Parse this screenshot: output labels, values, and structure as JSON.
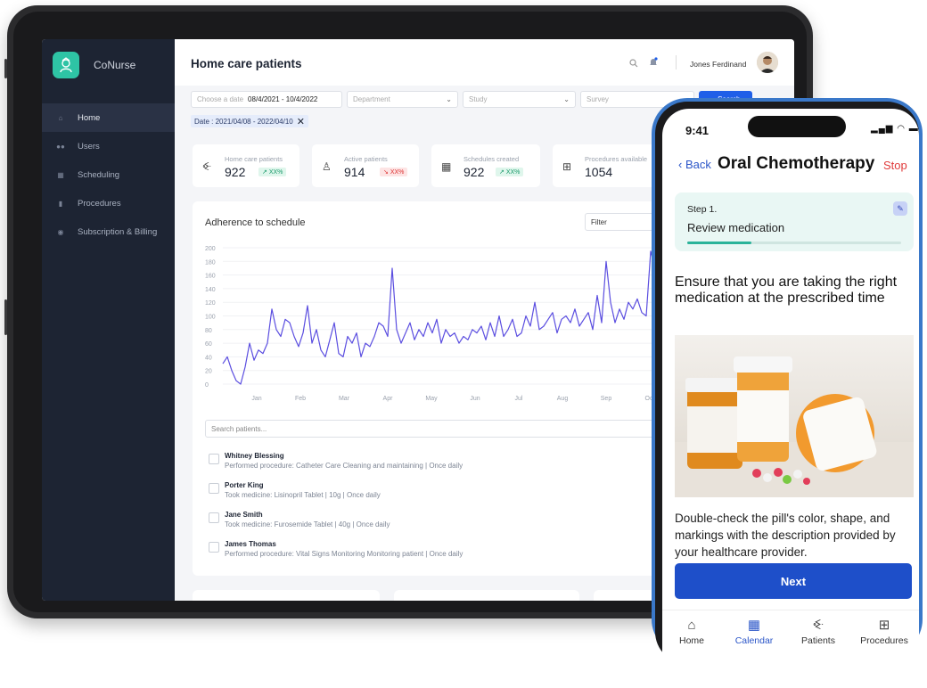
{
  "dashboard": {
    "brand": "CoNurse",
    "sidebar": {
      "items": [
        {
          "label": "Home",
          "icon": "home-icon"
        },
        {
          "label": "Users",
          "icon": "users-icon"
        },
        {
          "label": "Scheduling",
          "icon": "calendar-icon"
        },
        {
          "label": "Procedures",
          "icon": "clipboard-icon"
        },
        {
          "label": "Subscription & Billing",
          "icon": "billing-icon"
        }
      ]
    },
    "header": {
      "title": "Home care patients",
      "user_name": "Jones Ferdinand"
    },
    "filters": {
      "date_placeholder": "Choose a date",
      "date_value": "08/4/2021 - 10/4/2022",
      "department": "Department",
      "study": "Study",
      "survey": "Survey",
      "search_label": "Search",
      "date_chip": "Date : 2021/04/08 - 2022/04/10"
    },
    "stats": [
      {
        "label": "Home care patients",
        "value": "922",
        "change": "XX%",
        "trend": "up"
      },
      {
        "label": "Active patients",
        "value": "914",
        "change": "XX%",
        "trend": "down"
      },
      {
        "label": "Schedules created",
        "value": "922",
        "change": "XX%",
        "trend": "up"
      },
      {
        "label": "Procedures available",
        "value": "1054"
      }
    ],
    "chart_card": {
      "title": "Adherence to schedule",
      "filter": "Filter"
    },
    "patients_search_placeholder": "Search patients...",
    "patients": [
      {
        "name": "Whitney Blessing",
        "desc": "Performed procedure: Catheter Care  Cleaning and maintaining  |  Once daily"
      },
      {
        "name": "Porter King",
        "desc": "Took medicine:  Lisinopril  Tablet  |  10g  |  Once daily"
      },
      {
        "name": "Jane Smith",
        "desc": "Took medicine:  Furosemide  Tablet  |  40g  |  Once daily"
      },
      {
        "name": "James Thomas",
        "desc": "Performed procedure: Vital Signs Monitoring  Monitoring patient  |  Once daily"
      }
    ]
  },
  "chart_data": {
    "type": "line",
    "title": "Adherence to schedule",
    "xlabel": "",
    "ylabel": "",
    "ylim": [
      0,
      200
    ],
    "yticks": [
      200,
      180,
      160,
      140,
      120,
      100,
      80,
      60,
      40,
      20,
      0
    ],
    "xticks": [
      "Jan",
      "Feb",
      "Mar",
      "Apr",
      "May",
      "Jun",
      "Jul",
      "Aug",
      "Sep",
      "Oct"
    ],
    "grid": true,
    "series": [
      {
        "color": "#5b4ee0",
        "values": [
          30,
          40,
          20,
          5,
          0,
          25,
          60,
          35,
          50,
          45,
          60,
          110,
          80,
          70,
          95,
          90,
          70,
          55,
          75,
          115,
          60,
          80,
          50,
          40,
          65,
          90,
          45,
          40,
          70,
          60,
          75,
          40,
          60,
          55,
          70,
          90,
          85,
          70,
          170,
          80,
          60,
          75,
          90,
          65,
          80,
          70,
          90,
          75,
          95,
          60,
          80,
          70,
          75,
          60,
          70,
          65,
          80,
          75,
          85,
          65,
          90,
          70,
          100,
          70,
          80,
          95,
          70,
          75,
          100,
          85,
          120,
          80,
          85,
          95,
          105,
          75,
          95,
          100,
          90,
          110,
          85,
          95,
          105,
          80,
          130,
          90,
          180,
          120,
          90,
          110,
          95,
          120,
          110,
          125,
          105,
          100,
          195,
          170,
          130,
          150,
          115,
          140,
          160,
          110,
          170
        ]
      }
    ]
  },
  "phone": {
    "time": "9:41",
    "back": "Back",
    "title": "Oral Chemotherapy",
    "stop": "Stop",
    "step_label": "Step 1.",
    "step_title": "Review medication",
    "step_progress": 0.3,
    "heading": "Ensure that you are taking the right medication at the prescribed time",
    "body": "Double-check the pill's color, shape, and markings with the description provided by your healthcare provider.",
    "next": "Next",
    "tabs": [
      {
        "label": "Home",
        "icon": "home-icon"
      },
      {
        "label": "Calendar",
        "icon": "calendar-icon"
      },
      {
        "label": "Patients",
        "icon": "patients-icon"
      },
      {
        "label": "Procedures",
        "icon": "procedures-icon"
      }
    ]
  },
  "colors": {
    "sidebar_bg": "#1d2433",
    "accent_blue": "#1f5fe8",
    "line": "#5b4ee0",
    "brand_teal": "#2ec4a5",
    "stop_red": "#e03b3b"
  }
}
